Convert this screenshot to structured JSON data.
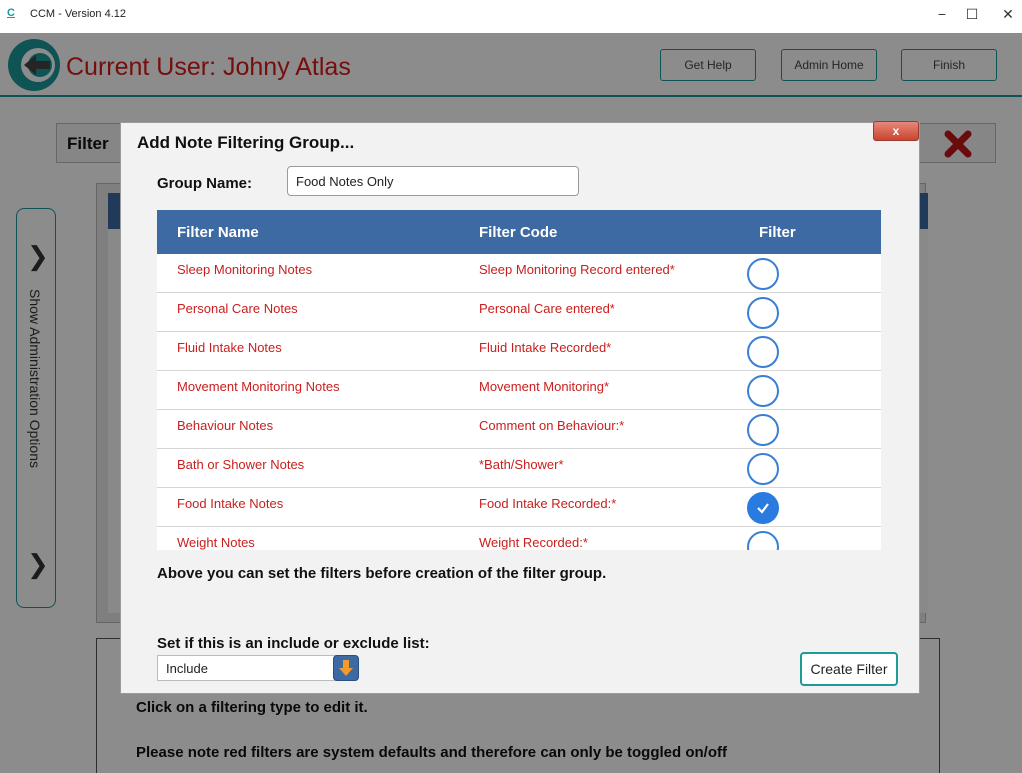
{
  "window": {
    "logo_letter": "C",
    "title": "CCM - Version 4.12",
    "minimize": "−",
    "maximize": "☐",
    "close": "✕"
  },
  "header": {
    "user_label": "Current User: Johny Atlas",
    "buttons": {
      "get_help": "Get Help",
      "admin_home": "Admin Home",
      "finish": "Finish"
    }
  },
  "background": {
    "panel_title": "Filter",
    "side_tab_label": "Show Administration Options",
    "side_tab_chevron": "❯",
    "bottom_line_1": "Click on a filtering type to edit it.",
    "bottom_line_2": "Please note red filters are system defaults and therefore can only be toggled on/off"
  },
  "modal": {
    "title": "Add Note Filtering Group...",
    "close_label": "x",
    "group_name_label": "Group Name:",
    "group_name_value": "Food Notes Only",
    "table": {
      "headers": {
        "name": "Filter Name",
        "code": "Filter Code",
        "filter": "Filter"
      },
      "rows": [
        {
          "name": "Sleep Monitoring Notes",
          "code": "Sleep Monitoring Record entered*",
          "checked": false
        },
        {
          "name": "Personal Care Notes",
          "code": "Personal Care entered*",
          "checked": false
        },
        {
          "name": "Fluid Intake Notes",
          "code": "Fluid Intake Recorded*",
          "checked": false
        },
        {
          "name": "Movement Monitoring Notes",
          "code": "Movement Monitoring*",
          "checked": false
        },
        {
          "name": "Behaviour Notes",
          "code": "Comment on Behaviour:*",
          "checked": false
        },
        {
          "name": "Bath or Shower Notes",
          "code": "*Bath/Shower*",
          "checked": false
        },
        {
          "name": "Food Intake Notes",
          "code": "Food Intake Recorded:*",
          "checked": true
        },
        {
          "name": "Weight Notes",
          "code": "Weight Recorded:*",
          "checked": false
        }
      ]
    },
    "note_text": "Above you can set the filters before creation of the filter group.",
    "include_label": "Set if this is an include or exclude list:",
    "include_value": "Include",
    "create_button": "Create Filter"
  },
  "colors": {
    "accent_teal": "#1d9a9a",
    "header_blue": "#3d6aa3",
    "system_red": "#c8201e",
    "check_blue": "#2a7be0"
  }
}
